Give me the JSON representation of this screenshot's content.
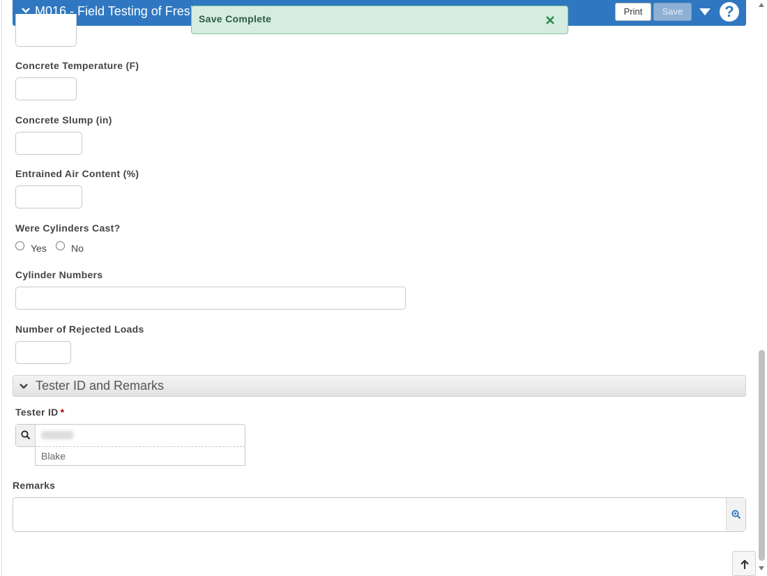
{
  "header": {
    "title": "M016 - Field Testing of Fresh Concrete",
    "print_label": "Print",
    "save_label": "Save"
  },
  "toast": {
    "message": "Save Complete"
  },
  "fields": {
    "concrete_temperature": {
      "label": "Concrete Temperature (F)",
      "value": ""
    },
    "concrete_slump": {
      "label": "Concrete Slump (in)",
      "value": ""
    },
    "entrained_air": {
      "label": "Entrained Air Content (%)",
      "value": ""
    },
    "cylinders_cast": {
      "label": "Were Cylinders Cast?",
      "options": [
        "Yes",
        "No"
      ],
      "selected": ""
    },
    "cylinder_numbers": {
      "label": "Cylinder Numbers",
      "value": ""
    },
    "rejected_loads": {
      "label": "Number of Rejected Loads",
      "value": ""
    }
  },
  "section": {
    "title": "Tester ID and Remarks"
  },
  "tester": {
    "label": "Tester ID",
    "required_marker": "*",
    "suggestion": "Blake"
  },
  "remarks": {
    "label": "Remarks",
    "value": ""
  },
  "colors": {
    "header": "#2f78c1",
    "toast_bg": "#d4ede0",
    "toast_text": "#2f5b3e",
    "required": "#b30000"
  },
  "icons": [
    "chevron-down-icon",
    "caret-down-icon",
    "help-icon",
    "close-icon",
    "search-icon",
    "zoom-in-icon",
    "arrow-up-icon"
  ]
}
